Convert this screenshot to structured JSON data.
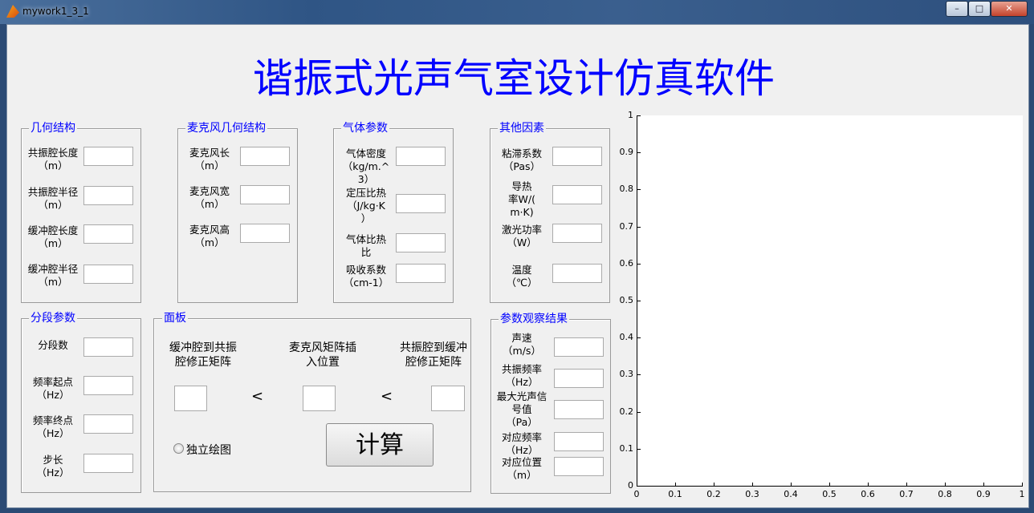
{
  "window": {
    "title": "mywork1_3_1",
    "min": "–",
    "max": "□",
    "close": "✕"
  },
  "main_title": "谐振式光声气室设计仿真软件",
  "geometry": {
    "title": "几何结构",
    "rows": [
      "共振腔长度\n（m）",
      "共振腔半径\n（m）",
      "缓冲腔长度\n（m）",
      "缓冲腔半径\n（m）"
    ]
  },
  "mic": {
    "title": "麦克风几何结构",
    "rows": [
      "麦克风长\n（m）",
      "麦克风宽\n（m）",
      "麦克风高\n（m）"
    ]
  },
  "gas": {
    "title": "气体参数",
    "rows": [
      "气体密度\n（kg/m.^\n3）",
      "定压比热\n（J/kg·K\n）",
      "气体比热\n比",
      "吸收系数\n（cm-1）"
    ]
  },
  "other": {
    "title": "其他因素",
    "rows": [
      "粘滞系数\n（Pas）",
      "导热\n率W/(\nm·K)",
      "激光功率\n（W）",
      "温度\n（℃）"
    ]
  },
  "segment": {
    "title": "分段参数",
    "rows": [
      "分段数",
      "频率起点\n（Hz）",
      "频率终点\n（Hz）",
      "步长\n（Hz）"
    ]
  },
  "panel": {
    "title": "面板",
    "col1": "缓冲腔到共振\n腔修正矩阵",
    "col2": "麦克风矩阵插\n入位置",
    "col3": "共振腔到缓冲\n腔修正矩阵",
    "lt1": "<",
    "lt2": "<",
    "radio_label": "独立绘图",
    "calc_label": "计算"
  },
  "results": {
    "title": "参数观察结果",
    "rows": [
      "声速\n（m/s）",
      "共振频率\n（Hz）",
      "最大光声信\n号值\n（Pa）",
      "对应频率\n（Hz）",
      "对应位置\n（m）"
    ]
  },
  "chart_data": {
    "type": "line",
    "xlim": [
      0,
      1
    ],
    "ylim": [
      0,
      1
    ],
    "xticks": [
      "0",
      "0.1",
      "0.2",
      "0.3",
      "0.4",
      "0.5",
      "0.6",
      "0.7",
      "0.8",
      "0.9",
      "1"
    ],
    "yticks": [
      "0",
      "0.1",
      "0.2",
      "0.3",
      "0.4",
      "0.5",
      "0.6",
      "0.7",
      "0.8",
      "0.9",
      "1"
    ],
    "series": []
  }
}
